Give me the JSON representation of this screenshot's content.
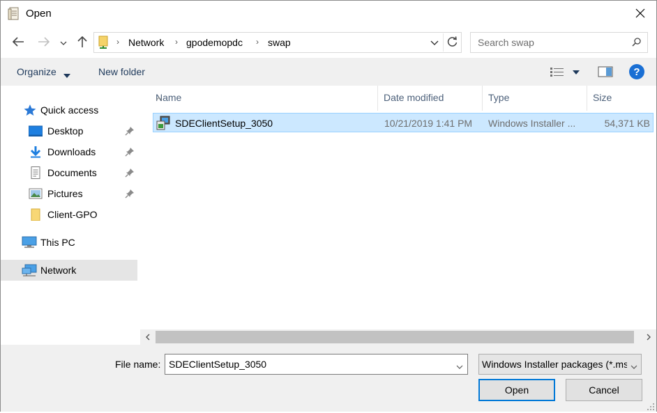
{
  "window": {
    "title": "Open"
  },
  "address": {
    "breadcrumbs": [
      "Network",
      "gpodemopdc",
      "swap"
    ]
  },
  "search": {
    "placeholder": "Search swap"
  },
  "toolbar": {
    "organize_label": "Organize",
    "new_folder_label": "New folder",
    "help_label": "?"
  },
  "navigation": {
    "items": [
      {
        "label": "Quick access",
        "icon": "star-icon",
        "pinned": false
      },
      {
        "label": "Desktop",
        "icon": "desktop-icon",
        "pinned": true
      },
      {
        "label": "Downloads",
        "icon": "download-icon",
        "pinned": true
      },
      {
        "label": "Documents",
        "icon": "documents-icon",
        "pinned": true
      },
      {
        "label": "Pictures",
        "icon": "pictures-icon",
        "pinned": true
      },
      {
        "label": "Client-GPO",
        "icon": "folder-icon",
        "pinned": false
      },
      {
        "label": "This PC",
        "icon": "computer-icon",
        "pinned": false
      },
      {
        "label": "Network",
        "icon": "network-icon",
        "pinned": false,
        "selected": true
      }
    ]
  },
  "file_list": {
    "columns": [
      "Name",
      "Date modified",
      "Type",
      "Size"
    ],
    "rows": [
      {
        "name": "SDEClientSetup_3050",
        "date_modified": "10/21/2019 1:41 PM",
        "type": "Windows Installer ...",
        "size": "54,371 KB",
        "selected": true
      }
    ]
  },
  "footer": {
    "file_name_label": "File name:",
    "file_name_value": "SDEClientSetup_3050",
    "file_type_filter": "Windows Installer packages (*.msi)",
    "open_label": "Open",
    "cancel_label": "Cancel"
  },
  "colors": {
    "selection_bg": "#cce8ff",
    "selection_border": "#99d1ff",
    "accent": "#0078d7",
    "link_text": "#1e395b"
  }
}
